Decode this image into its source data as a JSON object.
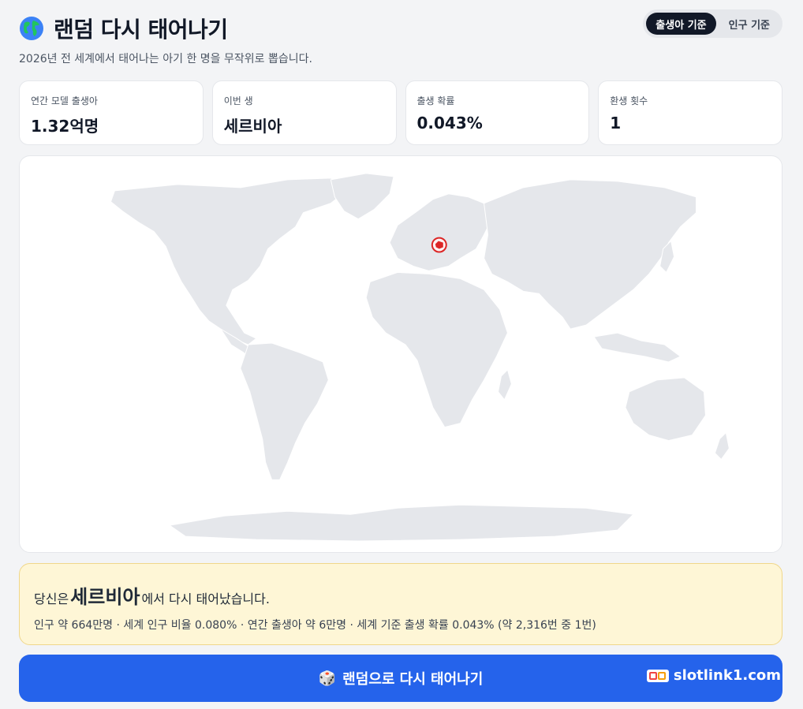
{
  "header": {
    "title": "랜덤 다시 태어나기",
    "subtitle": "2026년 전 세계에서 태어나는 아기 한 명을 무작위로 뽑습니다.",
    "toggle": {
      "option_births": "출생아 기준",
      "option_population": "인구 기준",
      "active": "option_births"
    }
  },
  "stats": [
    {
      "label": "연간 모델 출생아",
      "value": "1.32억명"
    },
    {
      "label": "이번 생",
      "value": "세르비아"
    },
    {
      "label": "출생 확률",
      "value": "0.043%"
    },
    {
      "label": "환생 횟수",
      "value": "1"
    }
  ],
  "map": {
    "marker_country": "세르비아",
    "marker_color": "#dc2626",
    "land_color": "#e5e7eb"
  },
  "result": {
    "prefix": "당신은",
    "country": "세르비아",
    "suffix": "에서 다시 태어났습니다.",
    "detail": "인구 약 664만명 · 세계 인구 비율 0.080% · 연간 출생아 약 6만명 · 세계 기준 출생 확률 0.043% (약 2,316번 중 1번)"
  },
  "cta": {
    "icon": "dice-icon",
    "label": "랜덤으로 다시 태어나기"
  },
  "watermark": {
    "text": "slotlink1.com"
  },
  "colors": {
    "accent": "#2563eb",
    "dark": "#111827",
    "result_bg": "#fef6d6"
  }
}
